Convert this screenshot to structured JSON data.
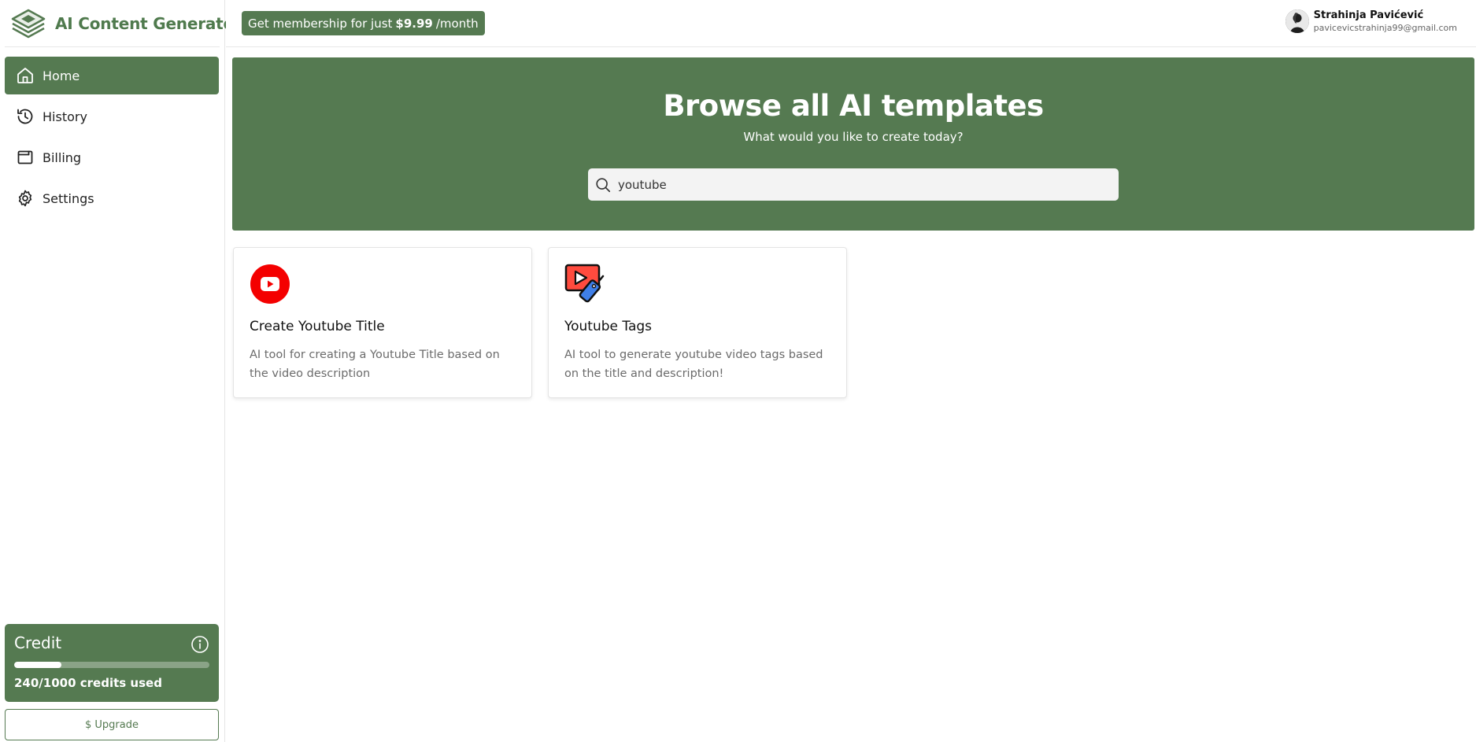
{
  "app": {
    "name": "AI Content Generator",
    "brand_color": "#557a51"
  },
  "sidebar": {
    "items": [
      {
        "label": "Home",
        "icon": "home-icon",
        "active": true
      },
      {
        "label": "History",
        "icon": "history-icon",
        "active": false
      },
      {
        "label": "Billing",
        "icon": "wallet-icon",
        "active": false
      },
      {
        "label": "Settings",
        "icon": "gear-icon",
        "active": false
      }
    ],
    "credit": {
      "title": "Credit",
      "used_text": "240/1000 credits used",
      "used": 240,
      "total": 1000
    },
    "upgrade_label": "$ Upgrade"
  },
  "header": {
    "promo_prefix": "Get membership for just",
    "promo_price": "$9.99",
    "promo_suffix": "/month",
    "user": {
      "name": "Strahinja Pavićević",
      "email": "pavicevicstrahinja99@gmail.com"
    }
  },
  "banner": {
    "title": "Browse all AI templates",
    "subtitle": "What would you like to create today?",
    "search_value": "youtube"
  },
  "templates": [
    {
      "title": "Create Youtube Title",
      "description": "AI tool for creating a Youtube Title based on the video description",
      "icon": "youtube-icon"
    },
    {
      "title": "Youtube Tags",
      "description": "AI tool to generate youtube video tags based on the title and description!",
      "icon": "video-tag-icon"
    }
  ]
}
